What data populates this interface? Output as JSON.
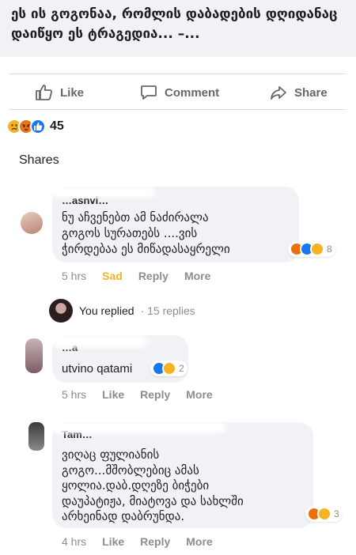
{
  "post": {
    "title": "ეს ის გოგონაა, რომლის დაბადების დღიდანაც დაიწყო ეს ტრაგედია... –..."
  },
  "actions": {
    "like": "Like",
    "comment": "Comment",
    "share": "Share"
  },
  "reactions": {
    "count": "45",
    "icons": [
      "sad",
      "angry",
      "like"
    ]
  },
  "shares_label": "Shares",
  "comments": [
    {
      "author": "…asnvi…",
      "text_lines": [
        "ნუ აჩვენებთ ამ ნაძირალა",
        "გოგოს სურათებს ....ვის",
        "ჭირდებაა ეს მიწადასაყრელი"
      ],
      "reaction_count": "8",
      "time": "5 hrs",
      "reacted": "Sad",
      "reply": "Reply",
      "more": "More"
    },
    {
      "author": "…a",
      "text_lines": [
        "utvino qatami"
      ],
      "reaction_count": "2",
      "time": "5 hrs",
      "like": "Like",
      "reply": "Reply",
      "more": "More"
    },
    {
      "author": "Tam…",
      "text_lines": [
        "ვიღაც ფულიანის",
        "გოგო...მშობლებიც ამას",
        "ყოლია.დაბ.დღეზე ბიჭები",
        "დაუპატიჟა, მიატოვა და სახლში",
        "არხეინად დაბრუნდა."
      ],
      "reaction_count": "3",
      "time": "4 hrs",
      "like": "Like",
      "reply": "Reply",
      "more": "More"
    }
  ],
  "replies": {
    "who": "You replied",
    "count": "· 15 replies"
  },
  "colors": {
    "like_blue": "#1877f2",
    "sad_yellow": "#f7b125",
    "angry_orange": "#e9710f",
    "meta_gray": "#8a8d91",
    "bubble_gray": "#f0f2f5"
  }
}
